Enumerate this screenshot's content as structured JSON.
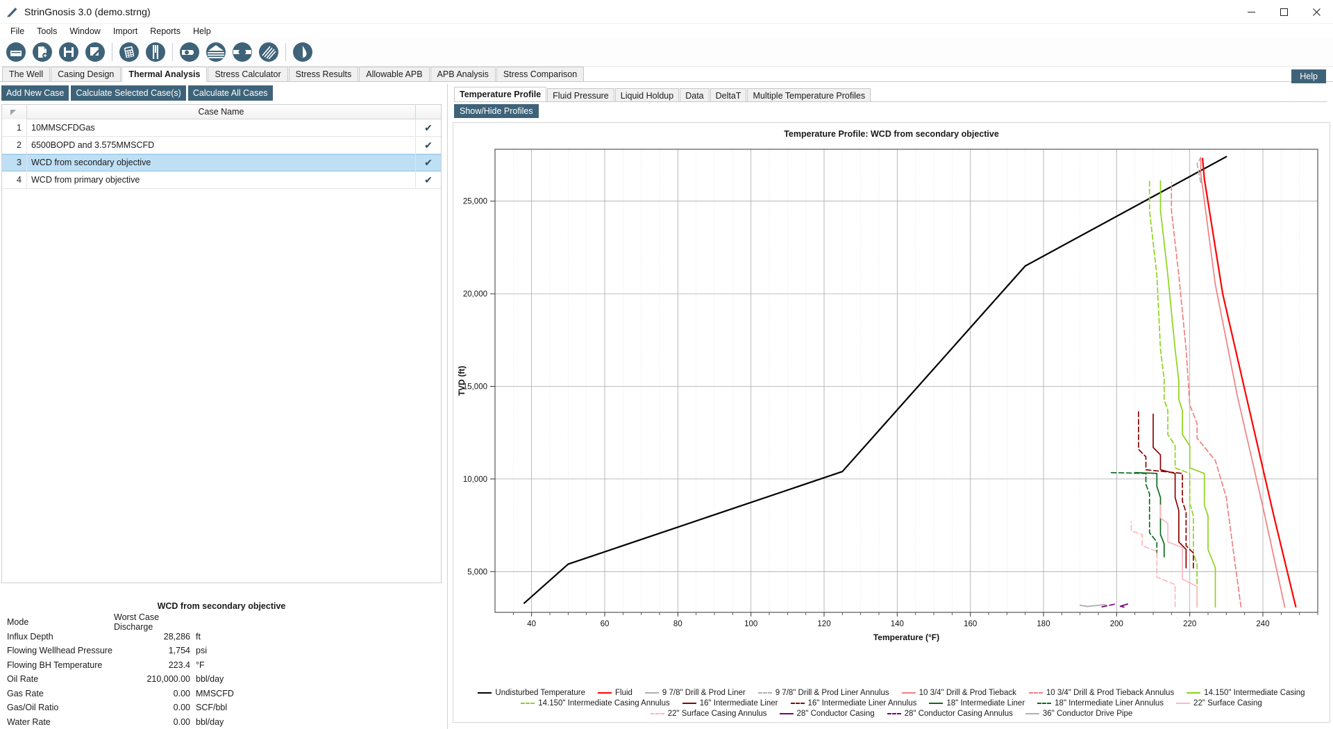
{
  "window": {
    "title": "StrinGnosis 3.0 (demo.strng)",
    "app_icon": "pen-icon",
    "controls": {
      "minimize": "minimize-icon",
      "maximize": "maximize-icon",
      "close": "close-icon"
    }
  },
  "menu": {
    "items": [
      "File",
      "Tools",
      "Window",
      "Import",
      "Reports",
      "Help"
    ]
  },
  "toolbar": {
    "groups": [
      [
        "open-file-icon",
        "new-file-icon",
        "save-file-icon",
        "edit-file-icon"
      ],
      [
        "calculator-icon",
        "tubing-icon"
      ],
      [
        "casing-shoe-icon",
        "layers-icon",
        "packer-icon",
        "drillpipe-icon"
      ],
      [
        "fluid-drop-icon"
      ]
    ]
  },
  "main_tabs": {
    "items": [
      "The Well",
      "Casing Design",
      "Thermal Analysis",
      "Stress Calculator",
      "Stress Results",
      "Allowable APB",
      "APB Analysis",
      "Stress Comparison"
    ],
    "active": "Thermal Analysis"
  },
  "section": {
    "title": "Thermal Analysis",
    "collapse_icon": "chevron-down-icon"
  },
  "left": {
    "actions": [
      "Add New Case",
      "Calculate Selected Case(s)",
      "Calculate All Cases"
    ],
    "grid": {
      "columns": [
        "",
        "Case Name",
        ""
      ],
      "check_glyph": "✔",
      "rows": [
        {
          "num": "1",
          "name": "10MMSCFDGas",
          "checked": true,
          "selected": false
        },
        {
          "num": "2",
          "name": "6500BOPD and 3.575MMSCFD",
          "checked": true,
          "selected": false
        },
        {
          "num": "3",
          "name": "WCD from secondary objective",
          "checked": true,
          "selected": true
        },
        {
          "num": "4",
          "name": "WCD from primary objective",
          "checked": true,
          "selected": false
        }
      ]
    },
    "properties": {
      "title": "WCD from secondary objective",
      "rows": [
        {
          "label": "Mode",
          "value": "Worst Case Discharge",
          "unit": "",
          "value_align": "left"
        },
        {
          "label": "Influx Depth",
          "value": "28,286",
          "unit": "ft"
        },
        {
          "label": "Flowing Wellhead Pressure",
          "value": "1,754",
          "unit": "psi"
        },
        {
          "label": "Flowing BH Temperature",
          "value": "223.4",
          "unit": "°F"
        },
        {
          "label": "Oil Rate",
          "value": "210,000.00",
          "unit": "bbl/day"
        },
        {
          "label": "Gas Rate",
          "value": "0.00",
          "unit": "MMSCFD"
        },
        {
          "label": "Gas/Oil Ratio",
          "value": "0.00",
          "unit": "SCF/bbl"
        },
        {
          "label": "Water Rate",
          "value": "0.00",
          "unit": "bbl/day"
        }
      ]
    }
  },
  "right": {
    "help_label": "Help",
    "tabs": {
      "items": [
        "Temperature Profile",
        "Fluid Pressure",
        "Liquid Holdup",
        "Data",
        "DeltaT",
        "Multiple Temperature Profiles"
      ],
      "active": "Temperature Profile"
    },
    "show_hide_label": "Show/Hide Profiles"
  },
  "chart_data": {
    "type": "line",
    "title": "Temperature Profile: WCD from secondary objective",
    "xlabel": "Temperature (°F)",
    "ylabel": "TVD (ft)",
    "xlim": [
      30,
      255
    ],
    "ylim": [
      27800,
      2800
    ],
    "xticks": [
      40,
      60,
      80,
      100,
      120,
      140,
      160,
      180,
      200,
      220,
      240
    ],
    "yticks": [
      5000,
      10000,
      15000,
      20000,
      25000
    ],
    "ytick_labels": [
      "5,000",
      "10,000",
      "15,000",
      "20,000",
      "25,000"
    ],
    "grid": true,
    "legend_position": "bottom",
    "series": [
      {
        "name": "Undisturbed Temperature",
        "color": "#000000",
        "style": "solid",
        "points": [
          [
            38,
            3300
          ],
          [
            50,
            5400
          ],
          [
            125,
            10400
          ],
          [
            175,
            21500
          ],
          [
            230,
            27400
          ]
        ]
      },
      {
        "name": "Fluid",
        "color": "#ff0000",
        "style": "solid",
        "points": [
          [
            249,
            3100
          ],
          [
            243,
            8000
          ],
          [
            236,
            14000
          ],
          [
            229,
            20000
          ],
          [
            224,
            26200
          ],
          [
            223.5,
            27300
          ]
        ]
      },
      {
        "name": "9 7/8\" Drill & Prod Liner",
        "color": "#b0b0b0",
        "style": "solid",
        "points": [
          [
            197,
            3220
          ],
          [
            192,
            3120
          ],
          [
            190,
            3180
          ]
        ]
      },
      {
        "name": "9 7/8\" Drill & Prod Liner Annulus",
        "color": "#b0b0b0",
        "style": "dashed",
        "points": [
          [
            223,
            26000
          ],
          [
            222,
            27000
          ],
          [
            223,
            27350
          ]
        ]
      },
      {
        "name": "10 3/4\" Drill & Prod Tieback",
        "color": "#f08080",
        "style": "solid",
        "points": [
          [
            246,
            3080
          ],
          [
            240,
            8500
          ],
          [
            233,
            14500
          ],
          [
            227,
            20500
          ],
          [
            223,
            26500
          ],
          [
            223,
            27350
          ]
        ]
      },
      {
        "name": "10 3/4\" Drill & Prod Tieback Annulus",
        "color": "#f08080",
        "style": "dashed",
        "points": [
          [
            234,
            3100
          ],
          [
            232,
            6000
          ],
          [
            230,
            9000
          ],
          [
            227,
            11000
          ],
          [
            222,
            12200
          ],
          [
            222,
            13000
          ],
          [
            220,
            14000
          ],
          [
            219,
            17000
          ],
          [
            217,
            21000
          ],
          [
            215,
            24500
          ],
          [
            215,
            26000
          ]
        ]
      },
      {
        "name": "14.150\" Intermediate Casing",
        "color": "#8ed41c",
        "style": "solid",
        "points": [
          [
            227,
            3080
          ],
          [
            227,
            5200
          ],
          [
            225,
            6200
          ],
          [
            225,
            8000
          ],
          [
            224,
            8600
          ],
          [
            224,
            10300
          ],
          [
            220,
            10600
          ],
          [
            220,
            11800
          ],
          [
            218,
            12400
          ],
          [
            218,
            13700
          ],
          [
            217,
            14300
          ],
          [
            217,
            15300
          ],
          [
            216,
            17000
          ],
          [
            214,
            21000
          ],
          [
            212,
            24500
          ],
          [
            212,
            26100
          ]
        ]
      },
      {
        "name": "14.150\" Intermediate Casing Annulus",
        "color": "#8ed41c",
        "style": "dashed",
        "points": [
          [
            222,
            3100
          ],
          [
            222,
            5400
          ],
          [
            221,
            6000
          ],
          [
            221,
            8000
          ],
          [
            220,
            8700
          ],
          [
            220,
            10300
          ],
          [
            216,
            10600
          ],
          [
            216,
            11800
          ],
          [
            214,
            12400
          ],
          [
            214,
            13700
          ],
          [
            213,
            14300
          ],
          [
            213,
            15400
          ],
          [
            212,
            17000
          ],
          [
            211,
            21000
          ],
          [
            209,
            24500
          ],
          [
            209,
            26200
          ]
        ]
      },
      {
        "name": "16\" Intermediate Liner",
        "color": "#8b0000",
        "style": "solid",
        "points": [
          [
            219,
            5200
          ],
          [
            219,
            6200
          ],
          [
            217,
            6600
          ],
          [
            217,
            8300
          ],
          [
            216,
            9000
          ],
          [
            216,
            10300
          ],
          [
            212,
            10500
          ],
          [
            212,
            11300
          ],
          [
            210,
            11700
          ],
          [
            210,
            13500
          ]
        ]
      },
      {
        "name": "16\" Intermediate Liner Annulus",
        "color": "#8b0000",
        "style": "dashed",
        "points": [
          [
            221,
            5200
          ],
          [
            221,
            6000
          ],
          [
            219,
            6400
          ],
          [
            219,
            8200
          ],
          [
            218,
            8800
          ],
          [
            218,
            10300
          ],
          [
            208,
            10500
          ],
          [
            208,
            11200
          ],
          [
            206,
            11600
          ],
          [
            206,
            13700
          ]
        ]
      },
      {
        "name": "18\" Intermediate Liner",
        "color": "#0b6b1f",
        "style": "solid",
        "points": [
          [
            213,
            5800
          ],
          [
            213,
            6500
          ],
          [
            212,
            7000
          ],
          [
            212,
            9000
          ],
          [
            211,
            9600
          ],
          [
            211,
            10300
          ],
          [
            205,
            10350
          ]
        ]
      },
      {
        "name": "18\" Intermediate Liner Annulus",
        "color": "#0b6b1f",
        "style": "dashed",
        "points": [
          [
            211,
            5900
          ],
          [
            211,
            6600
          ],
          [
            209,
            7100
          ],
          [
            209,
            9200
          ],
          [
            208,
            9700
          ],
          [
            208,
            10300
          ],
          [
            198,
            10350
          ]
        ]
      },
      {
        "name": "22\" Surface Casing",
        "color": "#ffb6c1",
        "style": "solid",
        "points": [
          [
            222,
            3080
          ],
          [
            222,
            4200
          ],
          [
            218,
            4600
          ],
          [
            218,
            6300
          ],
          [
            214,
            6600
          ],
          [
            214,
            7600
          ],
          [
            212,
            7900
          ],
          [
            212,
            8600
          ]
        ]
      },
      {
        "name": "22\" Surface Casing Annulus",
        "color": "#ffb6c1",
        "style": "dashed",
        "points": [
          [
            216,
            3100
          ],
          [
            216,
            4300
          ],
          [
            211,
            4700
          ],
          [
            211,
            6100
          ],
          [
            207,
            6400
          ],
          [
            207,
            7000
          ],
          [
            204,
            7200
          ],
          [
            204,
            7700
          ]
        ]
      },
      {
        "name": "28\" Conductor Casing",
        "color": "#7b007b",
        "style": "solid",
        "points": [
          [
            202,
            3080
          ],
          [
            201,
            3130
          ],
          [
            203,
            3250
          ]
        ]
      },
      {
        "name": "28\" Conductor Casing Annulus",
        "color": "#7b007b",
        "style": "dashed",
        "points": [
          [
            196,
            3100
          ],
          [
            198,
            3180
          ],
          [
            200,
            3270
          ]
        ]
      },
      {
        "name": "36\" Conductor Drive Pipe",
        "color": "#b0b0b0",
        "style": "solid",
        "points": [
          [
            190,
            3180
          ],
          [
            192,
            3120
          ],
          [
            197,
            3220
          ]
        ]
      }
    ]
  }
}
